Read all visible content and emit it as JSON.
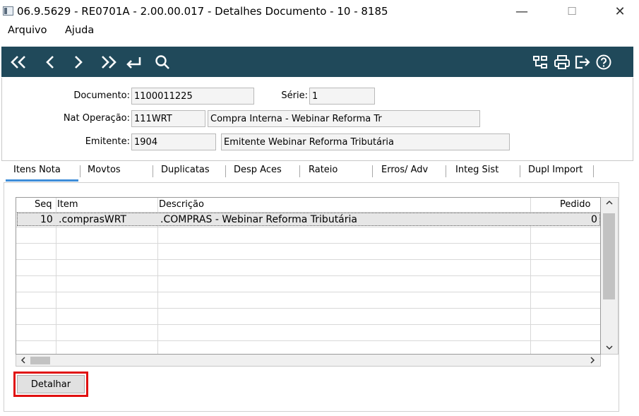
{
  "window": {
    "title": "06.9.5629 - RE0701A - 2.00.00.017 - Detalhes Documento - 10 - 8185",
    "minimize": "—",
    "maximize": "☐",
    "close": "✕"
  },
  "menu": {
    "items": [
      "Arquivo",
      "Ajuda"
    ]
  },
  "toolbar": {
    "left_icons": [
      "first-record-icon",
      "previous-record-icon",
      "next-record-icon",
      "last-record-icon",
      "return-icon",
      "search-icon"
    ],
    "right_icons": [
      "hierarchy-icon",
      "print-icon",
      "exit-icon",
      "help-icon"
    ],
    "background": "#20495a"
  },
  "form": {
    "documento_label": "Documento:",
    "documento_value": "1100011225",
    "serie_label": "Série:",
    "serie_value": "1",
    "nat_label": "Nat Operação:",
    "nat_code": "111WRT",
    "nat_desc": "Compra Interna - Webinar Reforma Tr",
    "emitente_label": "Emitente:",
    "emitente_code": "1904",
    "emitente_desc": "Emitente Webinar Reforma Tributária"
  },
  "tabs": [
    "Itens Nota",
    "Movtos",
    "Duplicatas",
    "Desp Aces",
    "Rateio",
    "Erros/ Adv",
    "Integ Sist",
    "Dupl Import"
  ],
  "active_tab": "Itens Nota",
  "grid": {
    "columns": [
      "Seq",
      "Item",
      "Descrição",
      "Pedido"
    ],
    "rows": [
      {
        "seq": "10",
        "item": ".comprasWRT",
        "descricao": ".COMPRAS - Webinar Reforma Tributária",
        "pedido": "0"
      }
    ]
  },
  "buttons": {
    "detalhar": "Detalhar"
  },
  "accent_colors": {
    "tab_underline": "#3e8dd9",
    "highlight_box": "#e01010"
  }
}
